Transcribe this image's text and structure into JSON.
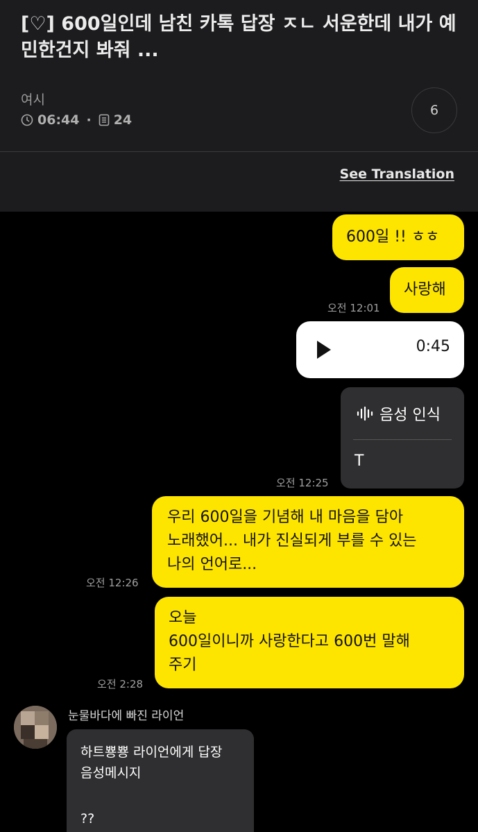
{
  "post": {
    "title": "[♡] 600일인데 남친 카톡 답장 ㅈㄴ 서운한데 내가 예민한건지 봐줘 ...",
    "author": "여시",
    "time": "06:44",
    "views": "24",
    "comment_count": "6",
    "translate_label": "See Translation"
  },
  "chat": {
    "messages": [
      {
        "text": "600일 !! ㅎㅎ"
      },
      {
        "text": "사랑해",
        "time": "오전 12:01"
      },
      {
        "voice_duration": "0:45"
      },
      {
        "stt_label": "음성 인식",
        "stt_text": "T",
        "time": "오전 12:25"
      },
      {
        "text": "우리 600일을 기념해 내 마음을 담아\n노래했어... 내가 진실되게 부를 수 있는\n나의 언어로...",
        "time": "오전 12:26"
      },
      {
        "text": "오늘\n600일이니까 사랑한다고 600번 말해\n주기",
        "time": "오전 2:28"
      }
    ],
    "reply": {
      "sender": "눈물바다에 빠진 라이언",
      "line1": "하트뿅뿅 라이언에게 답장",
      "line2": "음성메시지",
      "text": "??"
    }
  },
  "colors": {
    "bubble": "#fee500",
    "chat_bg": "#000000",
    "header_bg": "#1c1c1e"
  }
}
